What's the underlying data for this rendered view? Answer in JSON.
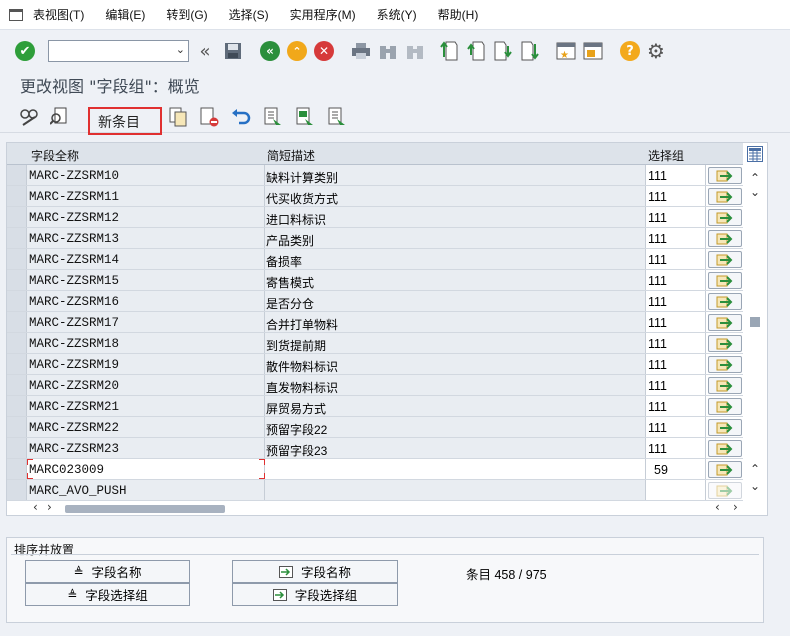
{
  "menu": [
    "表视图(T)",
    "编辑(E)",
    "转到(G)",
    "选择(S)",
    "实用程序(M)",
    "系统(Y)",
    "帮助(H)"
  ],
  "command_field": {
    "value": ""
  },
  "title": "更改视图 \"字段组\"：概览",
  "app_toolbar": {
    "new_entry_label": "新条目"
  },
  "table": {
    "headers": {
      "name": "字段全称",
      "desc": "简短描述",
      "group": "选择组"
    },
    "rows": [
      {
        "name": "MARC-ZZSRM10",
        "desc": "缺料计算类别",
        "group": "111"
      },
      {
        "name": "MARC-ZZSRM11",
        "desc": "代买收货方式",
        "group": "111"
      },
      {
        "name": "MARC-ZZSRM12",
        "desc": "进口料标识",
        "group": "111"
      },
      {
        "name": "MARC-ZZSRM13",
        "desc": "产品类别",
        "group": "111"
      },
      {
        "name": "MARC-ZZSRM14",
        "desc": "备损率",
        "group": "111"
      },
      {
        "name": "MARC-ZZSRM15",
        "desc": "寄售模式",
        "group": "111"
      },
      {
        "name": "MARC-ZZSRM16",
        "desc": "是否分仓",
        "group": "111"
      },
      {
        "name": "MARC-ZZSRM17",
        "desc": "合并打单物料",
        "group": "111"
      },
      {
        "name": "MARC-ZZSRM18",
        "desc": "到货提前期",
        "group": "111"
      },
      {
        "name": "MARC-ZZSRM19",
        "desc": "散件物料标识",
        "group": "111"
      },
      {
        "name": "MARC-ZZSRM20",
        "desc": "直发物料标识",
        "group": "111"
      },
      {
        "name": "MARC-ZZSRM21",
        "desc": "屏贸易方式",
        "group": "111"
      },
      {
        "name": "MARC-ZZSRM22",
        "desc": "预留字段22",
        "group": "111"
      },
      {
        "name": "MARC-ZZSRM23",
        "desc": "预留字段23",
        "group": "111"
      },
      {
        "name": "MARC023009",
        "desc": "",
        "group": "59"
      },
      {
        "name": "MARC_AVO_PUSH",
        "desc": "",
        "group": ""
      }
    ]
  },
  "sort_panel": {
    "title": "排序并放置",
    "btn_sort_name": "字段名称",
    "btn_sort_group": "字段选择组",
    "btn_pos_name": "字段名称",
    "btn_pos_group": "字段选择组",
    "entries": "条目 458 / 975"
  },
  "colors": {
    "accent_green": "#2e9e3a",
    "nav_green": "#2b8f3c",
    "nav_orange": "#f1a81a",
    "nav_red": "#d63a3a",
    "help_yellow": "#f3a91c",
    "highlight_red": "#e03030"
  }
}
